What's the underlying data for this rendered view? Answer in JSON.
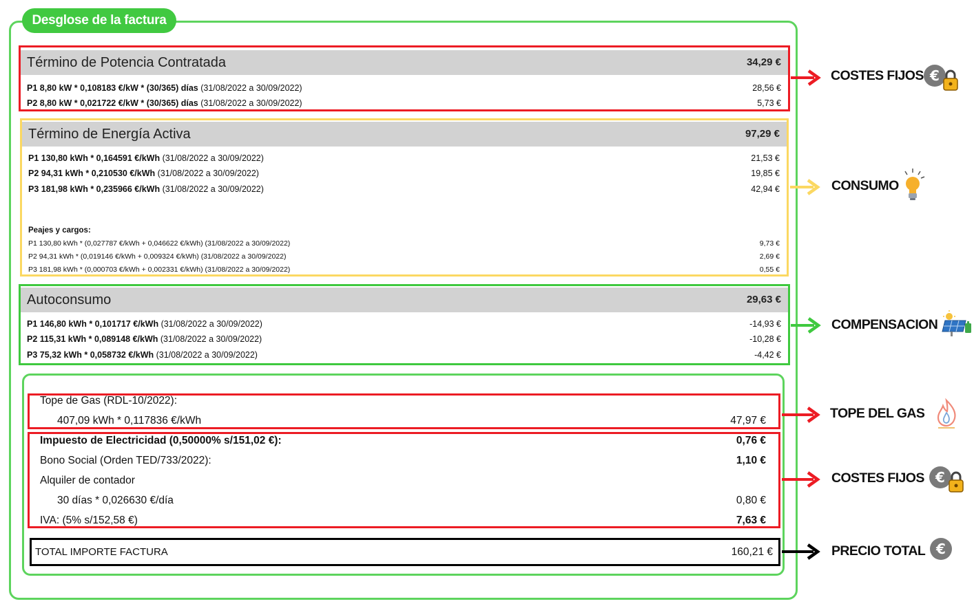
{
  "title": "Desglose de la factura",
  "potencia": {
    "title": "Término de Potencia Contratada",
    "total": "34,29 €",
    "rows": [
      {
        "bold": "P1 8,80 kW * 0,108183 €/kW * (30/365) días",
        "rest": " (31/08/2022 a 30/09/2022)",
        "amount": "28,56 €"
      },
      {
        "bold": "P2 8,80 kW * 0,021722 €/kW * (30/365) días",
        "rest": " (31/08/2022 a 30/09/2022)",
        "amount": "5,73 €"
      }
    ]
  },
  "energia": {
    "title": "Término de Energía Activa",
    "total": "97,29 €",
    "rows": [
      {
        "bold": "P1 130,80 kWh * 0,164591 €/kWh",
        "rest": " (31/08/2022 a 30/09/2022)",
        "amount": "21,53 €"
      },
      {
        "bold": "P2 94,31 kWh * 0,210530 €/kWh",
        "rest": " (31/08/2022 a 30/09/2022)",
        "amount": "19,85 €"
      },
      {
        "bold": "P3 181,98 kWh * 0,235966 €/kWh",
        "rest": " (31/08/2022 a 30/09/2022)",
        "amount": "42,94 €"
      }
    ],
    "peajes_title": "Peajes y cargos:",
    "peajes": [
      {
        "text": "P1 130,80 kWh * (0,027787 €/kWh + 0,046622 €/kWh) (31/08/2022 a 30/09/2022)",
        "amount": "9,73 €"
      },
      {
        "text": "P2 94,31 kWh * (0,019146 €/kWh + 0,009324 €/kWh) (31/08/2022 a 30/09/2022)",
        "amount": "2,69 €"
      },
      {
        "text": "P3 181,98 kWh * (0,000703 €/kWh + 0,002331 €/kWh) (31/08/2022 a 30/09/2022)",
        "amount": "0,55 €"
      }
    ]
  },
  "autoconsumo": {
    "title": "Autoconsumo",
    "total": "29,63 €",
    "rows": [
      {
        "bold": "P1 146,80 kWh * 0,101717 €/kWh",
        "rest": " (31/08/2022 a 30/09/2022)",
        "amount": "-14,93 €"
      },
      {
        "bold": "P2 115,31 kWh * 0,089148 €/kWh",
        "rest": " (31/08/2022 a 30/09/2022)",
        "amount": "-10,28 €"
      },
      {
        "bold": "P3 75,32 kWh * 0,058732 €/kWh",
        "rest": " (31/08/2022 a 30/09/2022)",
        "amount": "-4,42 €"
      }
    ]
  },
  "gas": {
    "title": "Tope de Gas (RDL-10/2022):",
    "detail": "407,09 kWh * 0,117836 €/kWh",
    "amount": "47,97 €"
  },
  "impuestos": {
    "electricidad": {
      "label": "Impuesto de Electricidad (0,50000% s/151,02 €):",
      "amount": "0,76 €"
    },
    "bono": {
      "label": "Bono Social (Orden TED/733/2022):",
      "amount": "1,10 €"
    },
    "alquiler": {
      "label": "Alquiler de contador",
      "detail": "30 días * 0,026630 €/día",
      "amount": "0,80 €"
    },
    "iva": {
      "label": "IVA: (5% s/152,58 €)",
      "amount": "7,63 €"
    }
  },
  "total": {
    "label": "TOTAL IMPORTE FACTURA",
    "amount": "160,21 €"
  },
  "annotations": {
    "costes_fijos_1": "COSTES FIJOS",
    "consumo": "CONSUMO",
    "compensacion": "COMPENSACION",
    "tope_gas": "TOPE  DEL GAS",
    "costes_fijos_2": "COSTES FIJOS",
    "precio_total": "PRECIO TOTAL"
  },
  "icons": {
    "euro_lock": "euro-lock-icon",
    "bulb": "lightbulb-icon",
    "solar": "solar-panel-icon",
    "flame": "gas-flame-icon",
    "euro": "euro-icon"
  },
  "colors": {
    "green": "#41c941",
    "red": "#ec1c24",
    "yellow": "#fbd862",
    "black": "#000000",
    "header_gray": "#d2d2d2"
  }
}
